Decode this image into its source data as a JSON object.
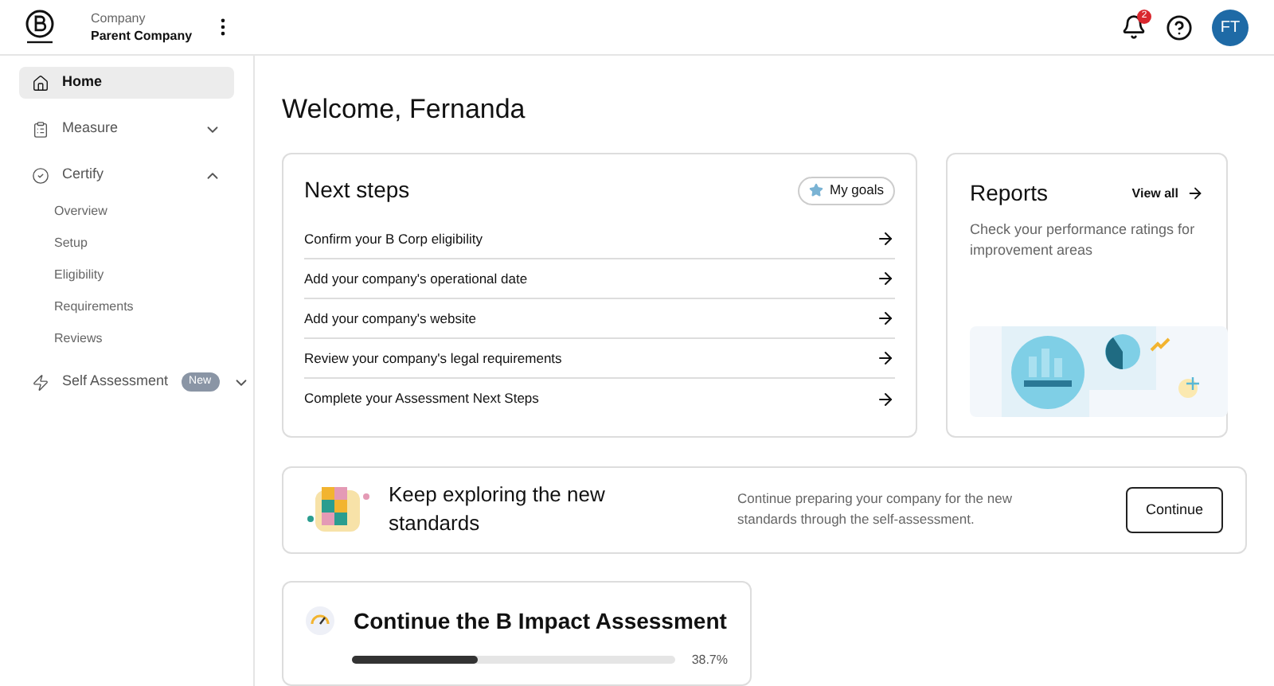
{
  "header": {
    "company_label": "Company",
    "company_name": "Parent Company",
    "notification_count": "2",
    "avatar_initials": "FT"
  },
  "sidebar": {
    "items": [
      {
        "kind": "home",
        "label": "Home",
        "selected": true
      },
      {
        "kind": "measure",
        "label": "Measure",
        "selected": false,
        "expanded": false
      },
      {
        "kind": "certify",
        "label": "Certify",
        "selected": false,
        "expanded": true,
        "children": [
          {
            "label": "Overview",
            "selected": false
          },
          {
            "label": "Setup",
            "selected": false
          },
          {
            "label": "Eligibility",
            "selected": false
          },
          {
            "label": "Requirements",
            "selected": false
          },
          {
            "label": "Reviews",
            "selected": false
          }
        ]
      },
      {
        "kind": "self_assessment",
        "label": "Self Assessment",
        "badge": "New",
        "selected": false,
        "expanded": false
      }
    ]
  },
  "welcome": "Welcome, Fernanda",
  "next_steps": {
    "title": "Next steps",
    "goals_button": "My goals",
    "items": [
      "Confirm your B Corp eligibility",
      "Add your company's operational date",
      "Add your company's website",
      "Review your company's legal requirements",
      "Complete your Assessment Next Steps"
    ]
  },
  "reports": {
    "title": "Reports",
    "view_all": "View all",
    "description": "Check your performance ratings for improvement areas"
  },
  "explore": {
    "title": "Keep exploring the new standards",
    "description": "Continue preparing your company for the new standards through the self-assessment.",
    "button": "Continue"
  },
  "assessment": {
    "title": "Continue the B Impact Assessment",
    "progress": {
      "level": 0.387,
      "reading": "38.7%"
    }
  }
}
